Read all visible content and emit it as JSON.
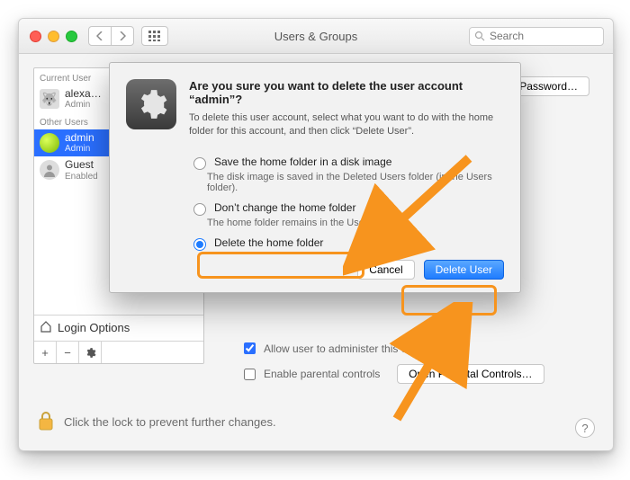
{
  "window": {
    "title": "Users & Groups",
    "search_placeholder": "Search"
  },
  "sidebar": {
    "current_header": "Current User",
    "current": {
      "name": "alexa…",
      "role": "Admin"
    },
    "other_header": "Other Users",
    "others": [
      {
        "name": "admin",
        "role": "Admin"
      },
      {
        "name": "Guest",
        "role": "Enabled"
      }
    ],
    "login_options": "Login Options"
  },
  "detail": {
    "reset_password": "Reset Password…",
    "allow_admin": "Allow user to administer this computer",
    "enable_parental": "Enable parental controls",
    "open_parental": "Open Parental Controls…"
  },
  "footer": {
    "lock_text": "Click the lock to prevent further changes."
  },
  "sheet": {
    "title": "Are you sure you want to delete the user account “admin”?",
    "subtitle": "To delete this user account, select what you want to do with the home folder for this account, and then click “Delete User”.",
    "options": [
      {
        "label": "Save the home folder in a disk image",
        "caption": "The disk image is saved in the Deleted Users folder (in the Users folder)."
      },
      {
        "label": "Don’t change the home folder",
        "caption": "The home folder remains in the Users folder."
      },
      {
        "label": "Delete the home folder",
        "selected": true
      }
    ],
    "cancel": "Cancel",
    "confirm": "Delete User"
  }
}
